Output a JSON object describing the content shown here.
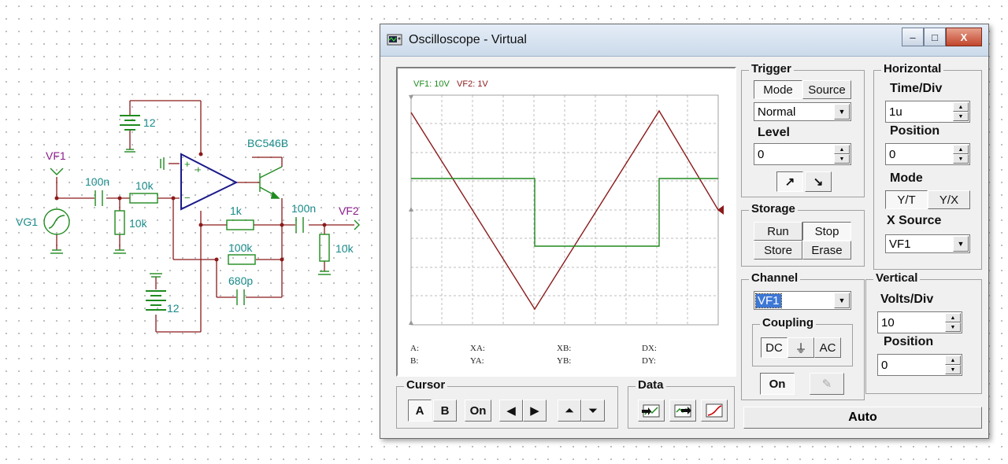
{
  "schematic": {
    "vf1": "VF1",
    "vf2": "VF2",
    "vg1": "VG1",
    "bat_top": "12",
    "bat_bot": "12",
    "transistor": "BC546B",
    "c_in": "100n",
    "r_series": "10k",
    "r_shunt": "10k",
    "r_fb1": "1k",
    "r_fb2": "100k",
    "c_fb": "680p",
    "c_out": "100n",
    "r_load": "10k"
  },
  "window": {
    "title": "Oscilloscope - Virtual",
    "min": "–",
    "max": "□",
    "close": "X"
  },
  "display": {
    "ch1_label": "VF1: 10V",
    "ch2_label": "VF2: 1V"
  },
  "cursor_readout": {
    "a": "A:",
    "b": "B:",
    "xa": "XA:",
    "ya": "YA:",
    "xb": "XB:",
    "yb": "YB:",
    "dx": "DX:",
    "dy": "DY:"
  },
  "trigger": {
    "title": "Trigger",
    "mode": "Mode",
    "source": "Source",
    "mode_value": "Normal",
    "level_label": "Level",
    "level_value": "0"
  },
  "horizontal": {
    "title": "Horizontal",
    "timediv_label": "Time/Div",
    "timediv_value": "1u",
    "position_label": "Position",
    "position_value": "0",
    "mode_label": "Mode",
    "yt": "Y/T",
    "yx": "Y/X",
    "xsource_label": "X Source",
    "xsource_value": "VF1"
  },
  "storage": {
    "title": "Storage",
    "run": "Run",
    "stop": "Stop",
    "store": "Store",
    "erase": "Erase"
  },
  "channel": {
    "title": "Channel",
    "value": "VF1",
    "coupling_title": "Coupling",
    "dc": "DC",
    "gnd": "⏚",
    "ac": "AC",
    "on": "On"
  },
  "vertical": {
    "title": "Vertical",
    "voltsdiv_label": "Volts/Div",
    "voltsdiv_value": "10",
    "position_label": "Position",
    "position_value": "0"
  },
  "cursor": {
    "title": "Cursor",
    "a": "A",
    "b": "B",
    "on": "On"
  },
  "data": {
    "title": "Data"
  },
  "auto": "Auto",
  "colors": {
    "vf1": "#1f8a1f",
    "vf2": "#8b1a1a",
    "schematic_text": "#1a8a8a",
    "probe_text": "#8a1a8a",
    "opamp": "#1a1a8a"
  }
}
